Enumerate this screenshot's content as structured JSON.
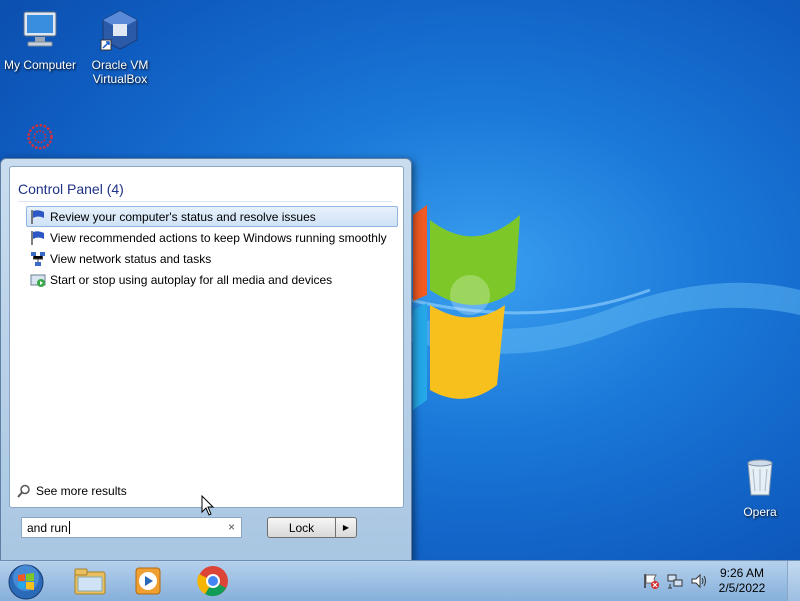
{
  "desktop": {
    "icons": [
      {
        "label": "My Computer"
      },
      {
        "label": "Oracle VM VirtualBox"
      },
      {
        "label": "Opera"
      }
    ]
  },
  "start_menu": {
    "section_title": "Control Panel (4)",
    "results": [
      {
        "label": "Review your computer's status and resolve issues",
        "icon": "flag-icon"
      },
      {
        "label": "View recommended actions to keep Windows running smoothly",
        "icon": "flag-icon"
      },
      {
        "label": "View network status and tasks",
        "icon": "network-icon"
      },
      {
        "label": "Start or stop using autoplay for all media and devices",
        "icon": "autoplay-icon"
      }
    ],
    "see_more": "See more results",
    "search_value": "and run",
    "clear_glyph": "×",
    "lock_label": "Lock",
    "lock_arrow": "▶"
  },
  "taskbar": {
    "items": [
      "start-orb-icon",
      "explorer-icon",
      "media-player-icon",
      "chrome-icon"
    ],
    "clock_time": "9:26 AM",
    "clock_date": "2/5/2022"
  },
  "colors": {
    "desktop_blue": "#1a78d8",
    "section_title": "#1e3287",
    "selection": "#cfe2f6"
  }
}
